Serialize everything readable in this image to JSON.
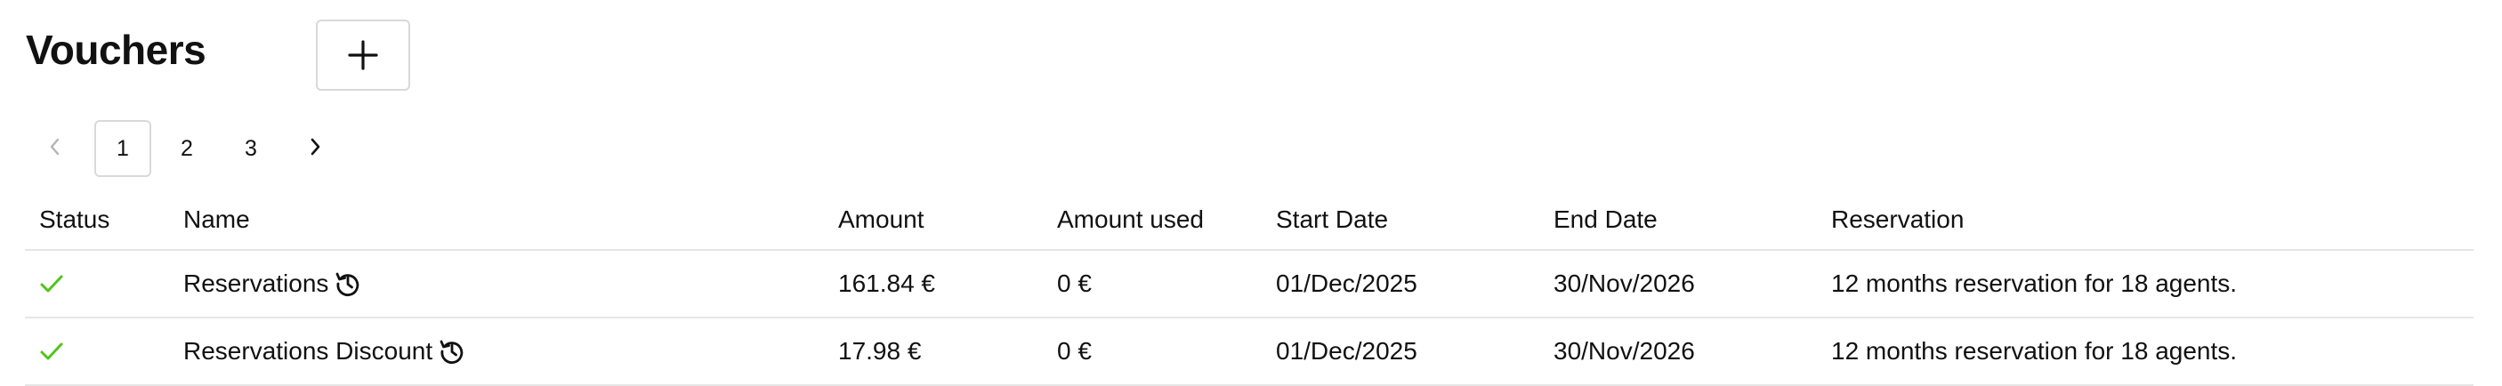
{
  "header": {
    "title": "Vouchers",
    "add_icon": "plus-icon"
  },
  "pagination": {
    "prev_icon": "chevron-left-icon",
    "next_icon": "chevron-right-icon",
    "pages": [
      "1",
      "2",
      "3"
    ],
    "current_page": "1"
  },
  "table": {
    "columns": [
      "Status",
      "Name",
      "Amount",
      "Amount used",
      "Start Date",
      "End Date",
      "Reservation"
    ],
    "rows": [
      {
        "status_icon": "check-icon",
        "status_color": "#52c41a",
        "name": "Reservations",
        "name_icon": "history-icon",
        "amount": "161.84 €",
        "amount_used": "0 €",
        "start_date": "01/Dec/2025",
        "end_date": "30/Nov/2026",
        "reservation": "12 months reservation for 18 agents."
      },
      {
        "status_icon": "check-icon",
        "status_color": "#52c41a",
        "name": "Reservations Discount",
        "name_icon": "history-icon",
        "amount": "17.98 €",
        "amount_used": "0 €",
        "start_date": "01/Dec/2025",
        "end_date": "30/Nov/2026",
        "reservation": "12 months reservation for 18 agents."
      }
    ]
  }
}
